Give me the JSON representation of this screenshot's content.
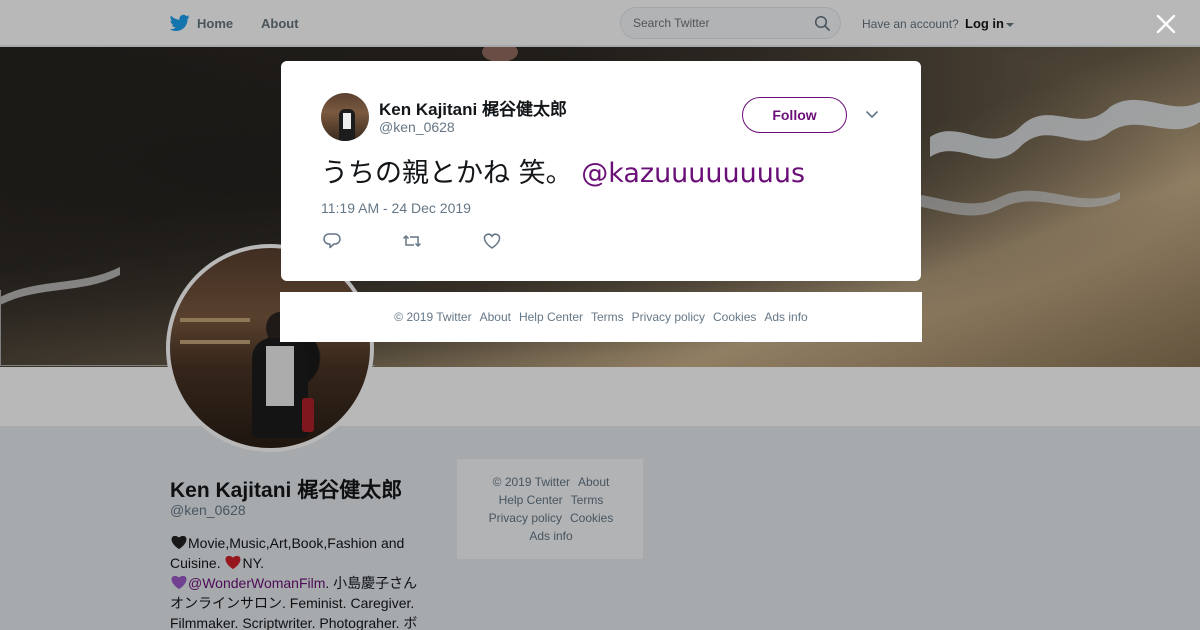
{
  "topbar": {
    "home_label": "Home",
    "about_label": "About",
    "search_placeholder": "Search Twitter",
    "have_account": "Have an account?",
    "login_label": "Log in"
  },
  "profile": {
    "name": "Ken Kajitani 梶谷健太郎",
    "handle": "@ken_0628",
    "bio_line1": "Movie,Music,Art,Book,Fashion and",
    "bio_line2_a": "Cuisine.",
    "bio_line2_b": "NY.",
    "bio_link": "@WonderWomanFilm",
    "bio_line3_rest": ". 小島慶子さん",
    "bio_line4": "オンラインサロン. Feminist. Caregiver.",
    "bio_line5": "Filmmaker. Scriptwriter. Photograher. ボ"
  },
  "side_footer": {
    "row1": [
      "© 2019 Twitter",
      "About"
    ],
    "row2": [
      "Help Center",
      "Terms"
    ],
    "row3": [
      "Privacy policy",
      "Cookies"
    ],
    "row4": [
      "Ads info"
    ]
  },
  "tweet": {
    "author_name": "Ken Kajitani 梶谷健太郎",
    "author_handle": "@ken_0628",
    "follow_label": "Follow",
    "text": "うちの親とかね 笑。",
    "mention": "@kazuuuuuuuus",
    "timestamp": "11:19 AM - 24 Dec 2019"
  },
  "modal_footer": {
    "links": [
      "© 2019 Twitter",
      "About",
      "Help Center",
      "Terms",
      "Privacy policy",
      "Cookies",
      "Ads info"
    ]
  },
  "icons": {
    "twitter_bird": "twitter-bird-icon",
    "search": "search-icon",
    "close": "close-icon",
    "reply": "reply-icon",
    "retweet": "retweet-icon",
    "like": "heart-icon",
    "more": "chevron-down-icon"
  },
  "colors": {
    "twitter_blue": "#1da1f2",
    "link_purple": "#6b0f78",
    "muted_text": "#657786"
  }
}
